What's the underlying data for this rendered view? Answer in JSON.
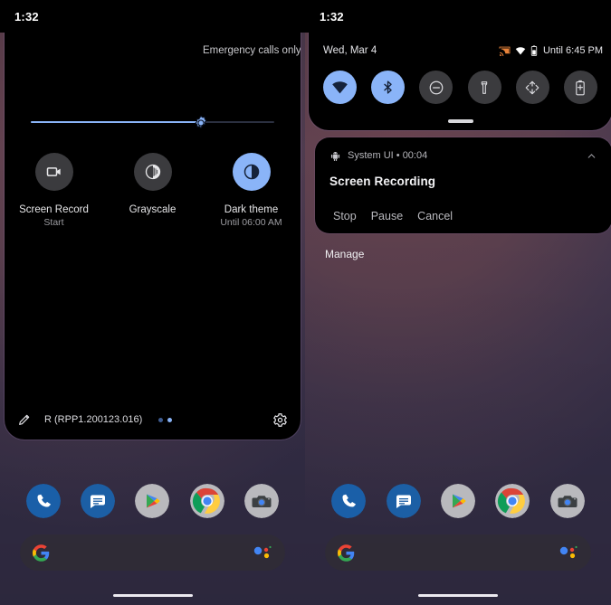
{
  "left_phone": {
    "statusbar": {
      "clock": "1:32"
    },
    "quick_settings": {
      "carrier_text": "Emergency calls only",
      "brightness": {
        "label": "brightness-slider",
        "value_percent": 70
      },
      "tiles": [
        {
          "label": "Screen Record",
          "sub": "Start",
          "icon": "screen-record-icon",
          "active": false
        },
        {
          "label": "Grayscale",
          "sub": "",
          "icon": "grayscale-icon",
          "active": false
        },
        {
          "label": "Dark theme",
          "sub": "Until 06:00 AM",
          "icon": "dark-theme-icon",
          "active": true
        }
      ],
      "footer": {
        "edit_icon": "pencil-icon",
        "build": "R (RPP1.200123.016)",
        "page_dots": 2,
        "active_dot": 2,
        "settings_icon": "gear-icon"
      }
    },
    "dock": [
      {
        "name": "Phone",
        "icon": "phone-icon"
      },
      {
        "name": "Messages",
        "icon": "messages-icon"
      },
      {
        "name": "Play Store",
        "icon": "play-store-icon"
      },
      {
        "name": "Chrome",
        "icon": "chrome-icon"
      },
      {
        "name": "Camera",
        "icon": "camera-icon"
      }
    ],
    "search": {
      "logo": "google-g-icon",
      "assistant": "assistant-mic-icon",
      "placeholder": ""
    }
  },
  "right_phone": {
    "statusbar": {
      "clock": "1:32"
    },
    "quick_settings": {
      "date": "Wed, Mar 4",
      "status_icons": [
        "cast-icon",
        "wifi-icon",
        "battery-icon"
      ],
      "battery_estimate": "Until 6:45 PM",
      "toggles": [
        {
          "name": "Wi-Fi",
          "icon": "wifi-icon",
          "active": true
        },
        {
          "name": "Bluetooth",
          "icon": "bluetooth-icon",
          "active": true
        },
        {
          "name": "Do Not Disturb",
          "icon": "do-not-disturb-icon",
          "active": false
        },
        {
          "name": "Flashlight",
          "icon": "flashlight-icon",
          "active": false
        },
        {
          "name": "Auto-rotate",
          "icon": "auto-rotate-icon",
          "active": false
        },
        {
          "name": "Battery Saver",
          "icon": "battery-saver-icon",
          "active": false
        }
      ]
    },
    "notification": {
      "app_icon": "android-icon",
      "app_line": "System UI • 00:04",
      "title": "Screen Recording",
      "actions": [
        "Stop",
        "Pause",
        "Cancel"
      ],
      "expand_icon": "chevron-up-icon"
    },
    "manage_label": "Manage",
    "dock": [
      {
        "name": "Phone",
        "icon": "phone-icon"
      },
      {
        "name": "Messages",
        "icon": "messages-icon"
      },
      {
        "name": "Play Store",
        "icon": "play-store-icon"
      },
      {
        "name": "Chrome",
        "icon": "chrome-icon"
      },
      {
        "name": "Camera",
        "icon": "camera-icon"
      }
    ],
    "search": {
      "logo": "google-g-icon",
      "assistant": "assistant-mic-icon",
      "placeholder": ""
    }
  },
  "colors": {
    "accent_blue": "#8ab4f8",
    "tile_off": "#3b3b3e",
    "panel_bg": "#000000",
    "wallpaper_top": "#6a4550",
    "wallpaper_bottom": "#332c47"
  }
}
